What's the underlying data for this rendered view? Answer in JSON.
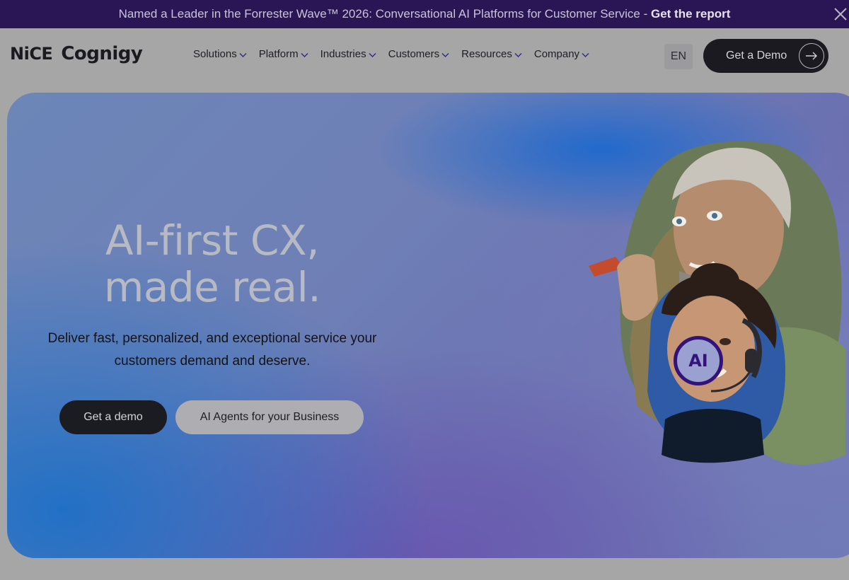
{
  "banner": {
    "text": "Named a Leader in the Forrester Wave™ 2026: Conversational AI Platforms for Customer Service - ",
    "link": "Get the report"
  },
  "header": {
    "logo_nice": "NiCE",
    "logo_cognigy": "Cognigy",
    "nav": [
      "Solutions",
      "Platform",
      "Industries",
      "Customers",
      "Resources",
      "Company"
    ],
    "lang": "EN",
    "demo_button": "Get a Demo"
  },
  "hero": {
    "title_line1": "AI-first CX,",
    "title_line2": "made real.",
    "subtitle": "Deliver fast, personalized, and exceptional service your customers demand and deserve.",
    "btn_demo": "Get a demo",
    "btn_agents": "AI Agents for your Business",
    "badge": "AI"
  }
}
